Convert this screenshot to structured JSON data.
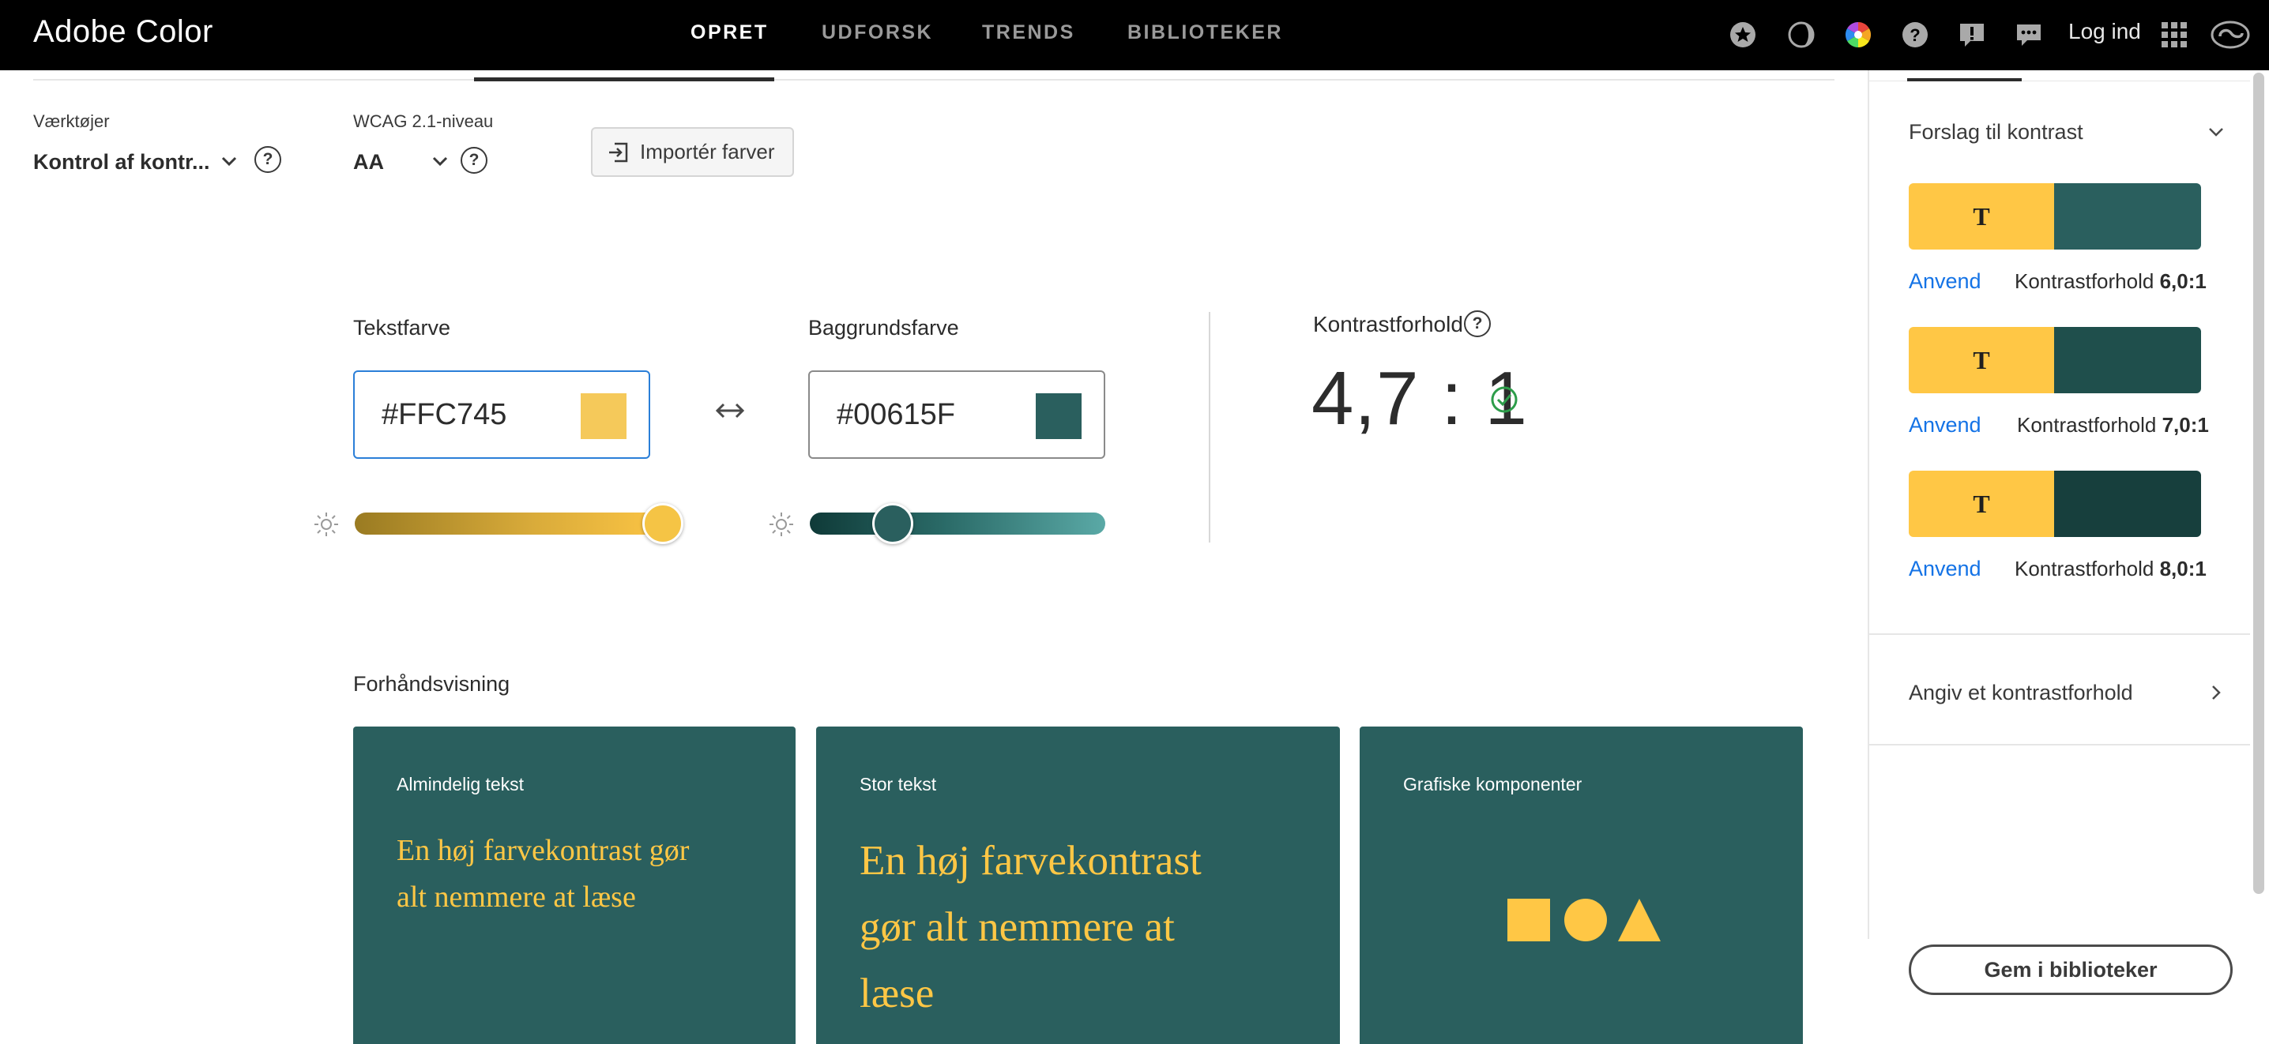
{
  "app": {
    "title": "Adobe Color"
  },
  "nav": {
    "tabs": [
      {
        "label": "OPRET",
        "active": true
      },
      {
        "label": "UDFORSK",
        "active": false
      },
      {
        "label": "TRENDS",
        "active": false
      },
      {
        "label": "BIBLIOTEKER",
        "active": false
      }
    ],
    "login_label": "Log ind",
    "icons": [
      "star-icon",
      "contrast-icon",
      "color-wheel-icon",
      "help-icon",
      "alert-icon",
      "chat-icon",
      "apps-grid-icon",
      "creative-cloud-icon"
    ]
  },
  "tools": {
    "tool_label": "Værktøjer",
    "tool_value": "Kontrol af kontr...",
    "wcag_label": "WCAG 2.1-niveau",
    "wcag_value": "AA",
    "help_glyph": "?",
    "import_label": "Importér farver"
  },
  "checker": {
    "text_color_label": "Tekstfarve",
    "text_color_hex": "#FFC745",
    "background_color_label": "Baggrundsfarve",
    "background_color_hex": "#00615F",
    "text_swatch_color": "#F5C95A",
    "background_swatch_color": "#2a5f5e",
    "text_brightness": 0.95,
    "background_brightness": 0.28,
    "ratio_label": "Kontrastforhold",
    "ratio_value": "4,7 : 1",
    "passes": true
  },
  "preview": {
    "label": "Forhåndsvisning",
    "cards": [
      {
        "title": "Almindelig tekst",
        "text_line1": "En høj farvekontrast gør",
        "text_line2": "alt nemmere at læse"
      },
      {
        "title": "Stor tekst",
        "text_line1": "En høj farvekontrast",
        "text_line2": "gør alt nemmere at",
        "text_line3": "læse"
      },
      {
        "title": "Grafiske komponenter"
      }
    ],
    "card_bg": "#2a5f5e",
    "accent": "#FFC745"
  },
  "suggestions": {
    "header": "Forslag til kontrast",
    "glyph": "T",
    "items": [
      {
        "apply_label": "Anvend",
        "ratio_prefix": "Kontrastforhold ",
        "ratio": "6,0:1",
        "bg": "#2a5f5e"
      },
      {
        "apply_label": "Anvend",
        "ratio_prefix": "Kontrastforhold ",
        "ratio": "7,0:1",
        "bg": "#1f4f4c"
      },
      {
        "apply_label": "Anvend",
        "ratio_prefix": "Kontrastforhold ",
        "ratio": "8,0:1",
        "bg": "#173f3d"
      }
    ],
    "set_ratio_label": "Angiv et kontrastforhold",
    "save_label": "Gem i biblioteker"
  }
}
